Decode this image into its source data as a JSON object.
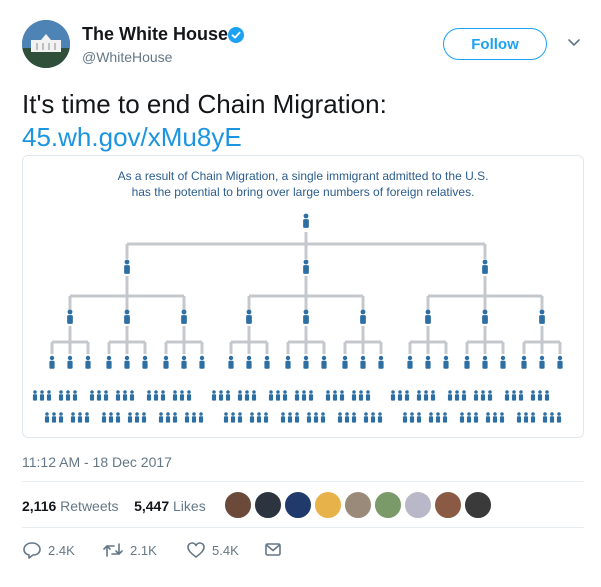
{
  "author": {
    "name": "The White House",
    "handle": "@WhiteHouse",
    "follow_label": "Follow"
  },
  "tweet": {
    "text": "It's time to end Chain Migration:",
    "link": "45.wh.gov/xMu8yE"
  },
  "card": {
    "caption_line1": "As a result of Chain Migration, a single immigrant admitted to the U.S.",
    "caption_line2": "has the potential to bring over large numbers of foreign relatives."
  },
  "timestamp": "11:12 AM - 18 Dec 2017",
  "stats": {
    "retweets_count": "2,116",
    "retweets_label": "Retweets",
    "likes_count": "5,447",
    "likes_label": "Likes"
  },
  "actions": {
    "replies": "2.4K",
    "retweets": "2.1K",
    "likes": "5.4K"
  },
  "colors": {
    "accent": "#1da1f2",
    "link": "#1b95e0",
    "figure": "#2d6ea3",
    "connector": "#c4c8cc"
  }
}
